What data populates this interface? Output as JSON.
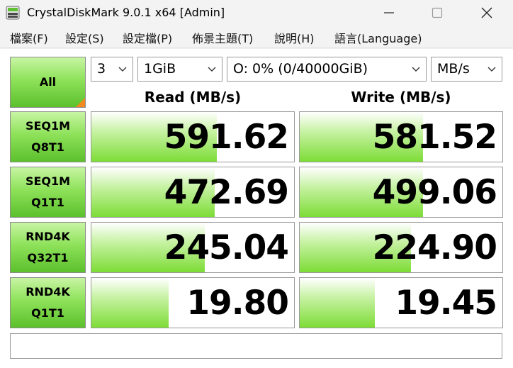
{
  "window": {
    "title": "CrystalDiskMark 9.0.1 x64 [Admin]"
  },
  "menu": [
    {
      "label": "檔案(F)"
    },
    {
      "label": "設定(S)"
    },
    {
      "label": "設定檔(P)"
    },
    {
      "label": "佈景主題(T)"
    },
    {
      "label": "說明(H)"
    },
    {
      "label": "語言(Language)"
    }
  ],
  "controls": {
    "all_label": "All",
    "count": "3",
    "size": "1GiB",
    "drive": "O: 0% (0/40000GiB)",
    "unit": "MB/s"
  },
  "columns": {
    "read": "Read (MB/s)",
    "write": "Write (MB/s)"
  },
  "tests": [
    {
      "line1": "SEQ1M",
      "line2": "Q8T1",
      "read": "591.62",
      "write": "581.52",
      "read_fill": 0.62,
      "write_fill": 0.61
    },
    {
      "line1": "SEQ1M",
      "line2": "Q1T1",
      "read": "472.69",
      "write": "499.06",
      "read_fill": 0.61,
      "write_fill": 0.61
    },
    {
      "line1": "RND4K",
      "line2": "Q32T1",
      "read": "245.04",
      "write": "224.90",
      "read_fill": 0.56,
      "write_fill": 0.55
    },
    {
      "line1": "RND4K",
      "line2": "Q1T1",
      "read": "19.80",
      "write": "19.45",
      "read_fill": 0.38,
      "write_fill": 0.37
    }
  ],
  "comment": "",
  "colors": {
    "button_green": "#7ddc36",
    "corner_orange": "#f08a1e"
  },
  "icons": [
    "app-icon",
    "minimize-icon",
    "maximize-icon",
    "close-icon",
    "chevron-down-icon"
  ]
}
